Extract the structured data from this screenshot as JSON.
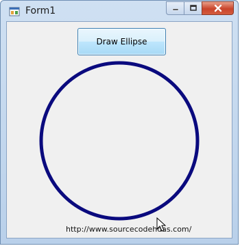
{
  "window": {
    "title": "Form1",
    "icons": {
      "app": "form-app-icon",
      "minimize": "minimize-icon",
      "maximize": "maximize-icon",
      "close": "close-icon"
    }
  },
  "form": {
    "draw_button_label": "Draw Ellipse",
    "ellipse_color": "#0a0a7e",
    "url_text": "http://www.sourcecodehdas.com/"
  },
  "colors": {
    "client_background": "#f0f0f0",
    "button_border": "#3c7fb1",
    "close_button": "#c9452c"
  }
}
